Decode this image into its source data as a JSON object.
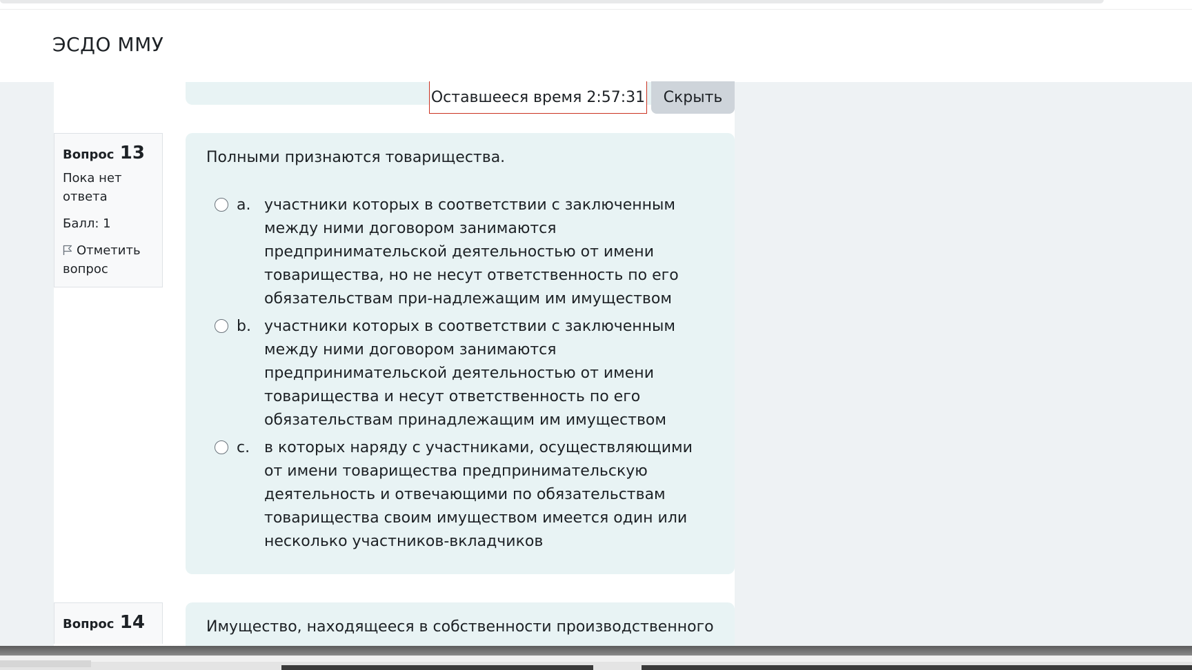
{
  "header": {
    "site_title": "ЭСДО ММУ"
  },
  "timer": {
    "label": "Оставшееся время 2:57:31",
    "hide_label": "Скрыть"
  },
  "questions": [
    {
      "label": "Вопрос",
      "number": "13",
      "state": "Пока нет ответа",
      "grade": "Балл: 1",
      "flag_label": "Отметить вопрос",
      "text": "Полными признаются товарищества.",
      "answers": [
        {
          "letter": "a.",
          "text": "участники которых в соответствии с заключенным между ними договором занимаются предпринимательской деятельностью от имени товарищества, но не несут ответственность по его обязательствам при-надлежащим им имуществом"
        },
        {
          "letter": "b.",
          "text": "участники которых в соответствии с заключенным между ними договором занимаются предпринимательской деятельностью от имени товарищества и несут ответственность по его обязательствам принадлежащим им имуществом"
        },
        {
          "letter": "c.",
          "text": "в которых наряду с участниками, осуществляющими от имени товарищества предпринимательскую деятельность и отвечающими по обязательствам товарищества своим имуществом имеется один или несколько участников-вкладчиков"
        }
      ]
    },
    {
      "label": "Вопрос",
      "number": "14",
      "text": "Имущество, находящееся в собственности производственного"
    }
  ],
  "icons": {
    "flag": "flag-icon",
    "radio": "radio-icon"
  }
}
